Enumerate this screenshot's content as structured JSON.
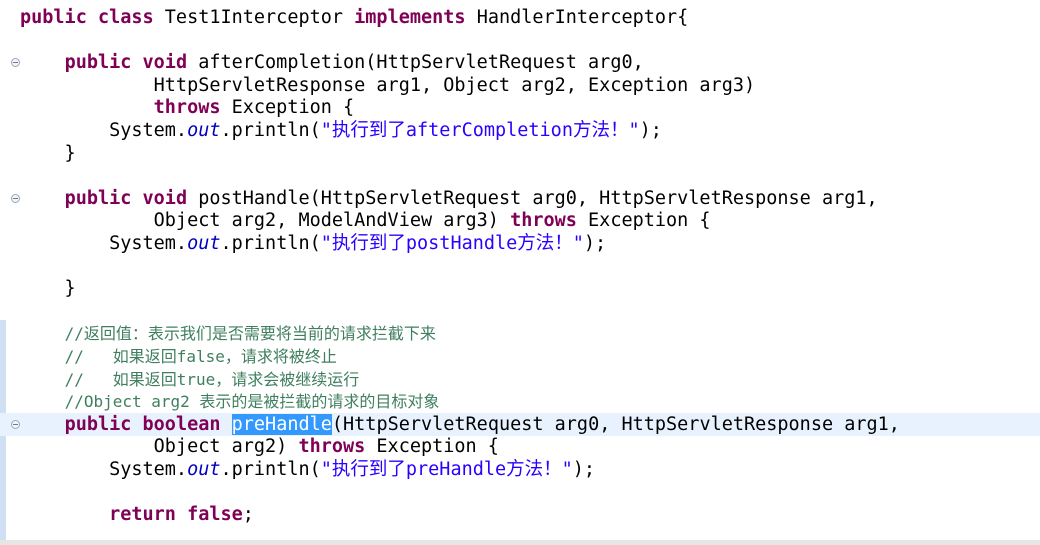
{
  "editor": {
    "lines": [
      [
        {
          "t": "public class ",
          "c": "kw"
        },
        {
          "t": "Test1Interceptor "
        },
        {
          "t": "implements ",
          "c": "kw"
        },
        {
          "t": "HandlerInterceptor{"
        }
      ],
      [],
      [
        {
          "t": "    "
        },
        {
          "t": "public void ",
          "c": "kw"
        },
        {
          "t": "afterCompletion(HttpServletRequest arg0,"
        }
      ],
      [
        {
          "t": "            HttpServletResponse arg1, Object arg2, Exception arg3)"
        }
      ],
      [
        {
          "t": "            "
        },
        {
          "t": "throws ",
          "c": "kw"
        },
        {
          "t": "Exception {"
        }
      ],
      [
        {
          "t": "        System."
        },
        {
          "t": "out",
          "c": "field"
        },
        {
          "t": ".println("
        },
        {
          "t": "\"执行到了afterCompletion方法！\"",
          "c": "str"
        },
        {
          "t": ");"
        }
      ],
      [
        {
          "t": "    }"
        }
      ],
      [],
      [
        {
          "t": "    "
        },
        {
          "t": "public void ",
          "c": "kw"
        },
        {
          "t": "postHandle(HttpServletRequest arg0, HttpServletResponse arg1,"
        }
      ],
      [
        {
          "t": "            Object arg2, ModelAndView arg3) "
        },
        {
          "t": "throws ",
          "c": "kw"
        },
        {
          "t": "Exception {"
        }
      ],
      [
        {
          "t": "        System."
        },
        {
          "t": "out",
          "c": "field"
        },
        {
          "t": ".println("
        },
        {
          "t": "\"执行到了postHandle方法！\"",
          "c": "str"
        },
        {
          "t": ");"
        }
      ],
      [],
      [
        {
          "t": "    }"
        }
      ],
      [],
      [
        {
          "t": "    "
        },
        {
          "t": "//返回值：表示我们是否需要将当前的请求拦截下来",
          "c": "cm"
        }
      ],
      [
        {
          "t": "    "
        },
        {
          "t": "//   如果返回false，请求将被终止",
          "c": "cm"
        }
      ],
      [
        {
          "t": "    "
        },
        {
          "t": "//   如果返回true，请求会被继续运行",
          "c": "cm"
        }
      ],
      [
        {
          "t": "    "
        },
        {
          "t": "//Object arg2 表示的是被拦截的请求的目标对象",
          "c": "cm"
        }
      ],
      [
        {
          "t": "    "
        },
        {
          "t": "public boolean ",
          "c": "kw"
        },
        {
          "t": "preHandle",
          "c": "sel"
        },
        {
          "t": "(HttpServletRequest arg0, HttpServletResponse arg1,"
        }
      ],
      [
        {
          "t": "            Object arg2) "
        },
        {
          "t": "throws ",
          "c": "kw"
        },
        {
          "t": "Exception {"
        }
      ],
      [
        {
          "t": "        System."
        },
        {
          "t": "out",
          "c": "field"
        },
        {
          "t": ".println("
        },
        {
          "t": "\"执行到了preHandle方法！\"",
          "c": "str"
        },
        {
          "t": ");"
        }
      ],
      [],
      [
        {
          "t": "        "
        },
        {
          "t": "return false",
          "c": "kw"
        },
        {
          "t": ";"
        }
      ]
    ],
    "current_line": 18,
    "fold_markers_on_lines": [
      2,
      8,
      18
    ],
    "colors": {
      "keyword": "#7f0055",
      "static_field": "#0000c0",
      "string": "#2a00ff",
      "comment": "#3f7f5f",
      "selection": "#3399ff",
      "current_line": "#e8f2fe"
    }
  }
}
